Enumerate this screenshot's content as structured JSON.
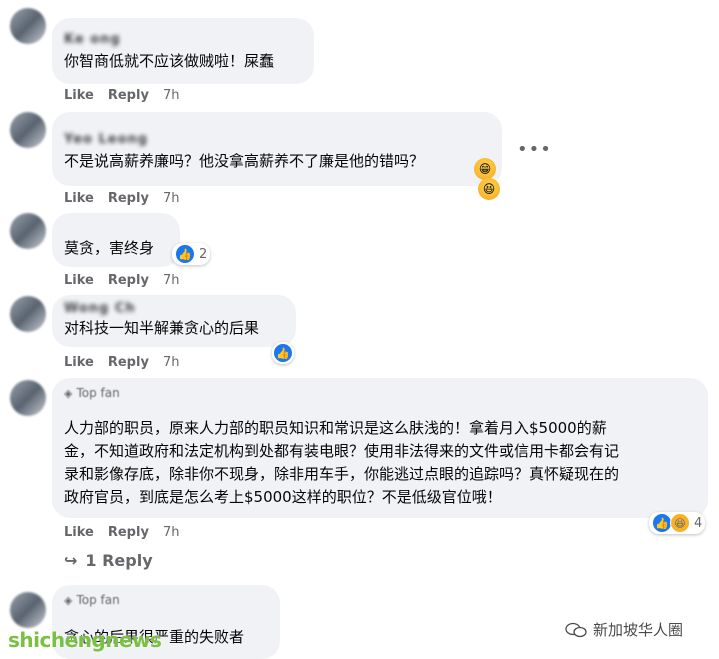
{
  "comments": [
    {
      "author": "Ke     ong",
      "text": "你智商低就不应该做贼啦！屎蠢",
      "like": "Like",
      "reply": "Reply",
      "time": "7h"
    },
    {
      "author": "Yeo Leong",
      "text": "不是说高薪养廉吗？他没拿高薪养不了廉是他的错吗？",
      "like": "Like",
      "reply": "Reply",
      "time": "7h",
      "emoji": "haha"
    },
    {
      "author": "",
      "text": "莫贪，害终身",
      "like": "Like",
      "reply": "Reply",
      "time": "7h",
      "reaction_count": "2"
    },
    {
      "author": "Wong Ch",
      "text": "对科技一知半解兼贪心的后果",
      "like": "Like",
      "reply": "Reply",
      "time": "7h"
    },
    {
      "badge": "Top fan",
      "author": "",
      "text_lines": [
        "人力部的职员，原来人力部的职员知识和常识是这么肤浅的！拿着月入$5000的薪",
        "金，不知道政府和法定机构到处都有装电眼？使用非法得来的文件或信用卡都会有记",
        "录和影像存底，除非你不现身，除非用车手，你能逃过点眼的追踪吗？真怀疑现在的",
        "政府官员，到底是怎么考上$5000这样的职位？不是低级官位哦！"
      ],
      "like": "Like",
      "reply": "Reply",
      "time": "7h",
      "reaction_count": "4",
      "replies_link": "1 Reply"
    },
    {
      "badge": "Top fan",
      "text": "贪心的后果很严重的失败者"
    }
  ],
  "more_icon": "more-dots-icon",
  "colors": {
    "bubble": "#f0f2f5",
    "like_blue": "#1877f2",
    "muted": "#65676b"
  },
  "watermark_left": "shichengnews",
  "watermark_right": "新加坡华人圈"
}
